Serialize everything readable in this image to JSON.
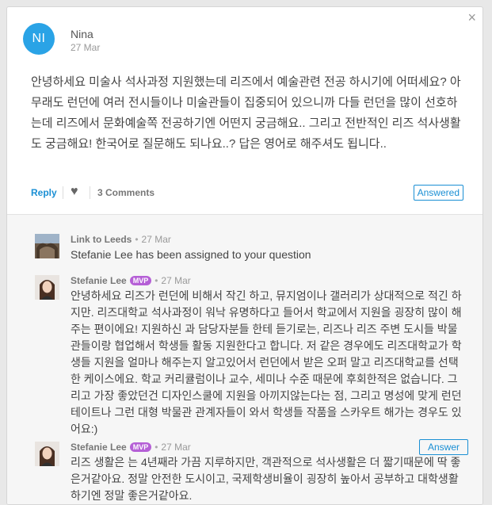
{
  "question": {
    "avatar_initials": "NI",
    "author": "Nina",
    "date": "27 Mar",
    "body": "안녕하세요 미술사 석사과정 지원했는데 리즈에서 예술관련 전공 하시기에 어떠세요? 아무래도 런던에 여러 전시들이나 미술관들이 집중되어 있으니까 다들 런던을 많이 선호하는데 리즈에서 문화예술쪽 전공하기엔 어떤지 궁금해요.. 그리고 전반적인 리즈 석사생활도 궁금해요! 한국어로 질문해도 되나요..? 답은 영어로 해주셔도 됩니다..",
    "reply_label": "Reply",
    "comments_label": "3 Comments",
    "answered_label": "Answered",
    "close_symbol": "×"
  },
  "comments": [
    {
      "author": "Link to Leeds",
      "date": "27 Mar",
      "mvp": "",
      "text": "Stefanie Lee has been assigned to your question"
    },
    {
      "author": "Stefanie Lee",
      "date": "27 Mar",
      "mvp": "MVP",
      "text": "안녕하세요 리즈가 런던에 비해서 작긴 하고, 뮤지엄이나 갤러리가 상대적으로 적긴 하지만. 리즈대학교 석사과정이 워낙 유명하다고 들어서 학교에서 지원을 굉장히 많이 해주는 편이에요! 지원하신 과 담당자분들 한테 듣기로는, 리즈나 리즈 주변 도시들 박물관들이랑 협업해서 학생들 활동 지원한다고 합니다. 저 같은 경우에도 리즈대학교가 학생들 지원을 얼마나 해주는지 알고있어서 런던에서 받은 오퍼 말고 리즈대학교를 선택한 케이스에요. 학교 커리큘럼이나 교수, 세미나 수준 때문에 후회한적은 없습니다. 그리고 가장 좋았던건 디자인스쿨에 지원을 아끼지않는다는 점, 그리고 명성에 맞게 런던 테이트나 그런 대형 박물관 관계자들이 와서 학생들 작품을 스카우트 해가는 경우도 있어요:)"
    },
    {
      "author": "Stefanie Lee",
      "date": "27 Mar",
      "mvp": "MVP",
      "text": "리즈 생활은 는 4년째라 가끔 지루하지만, 객관적으로 석사생활은 더 짧기때문에 딱 좋은거같아요. 정말 안전한 도시이고, 국제학생비율이 굉장히 높아서 공부하고 대학생활하기엔 정말 좋은거같아요.",
      "answer_label": "Answer"
    }
  ],
  "colors": {
    "accent": "#1a8fd4",
    "avatar": "#2aa3e6",
    "mvp": "#b55fd6"
  }
}
